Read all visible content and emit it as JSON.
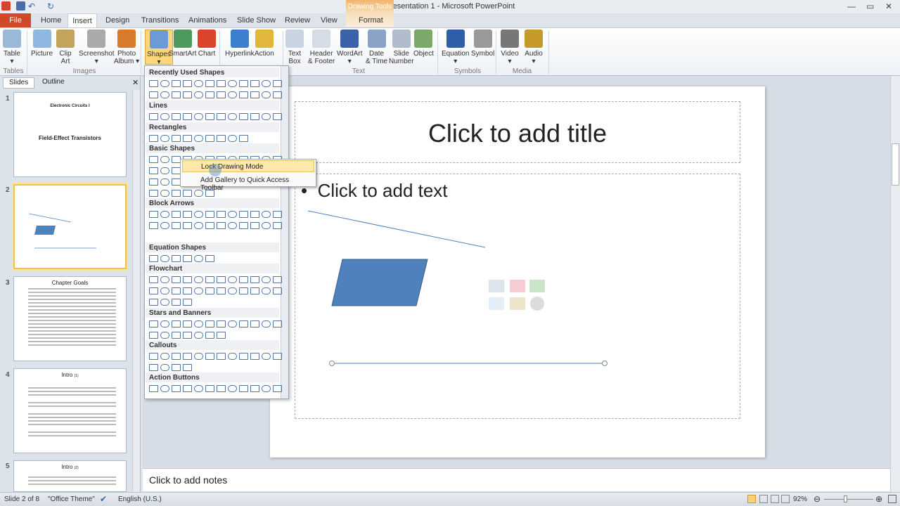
{
  "window": {
    "title": "Presentation 1  -  Microsoft PowerPoint",
    "context_tab": "Drawing Tools"
  },
  "tabs": [
    "File",
    "Home",
    "Insert",
    "Design",
    "Transitions",
    "Animations",
    "Slide Show",
    "Review",
    "View",
    "Format"
  ],
  "ribbon": {
    "buttons": [
      {
        "label": "Table",
        "sub": "▾",
        "icon": "table-icon"
      },
      {
        "label": "Picture",
        "sub": "",
        "icon": "picture-icon"
      },
      {
        "label": "Clip",
        "sub": "Art",
        "icon": "clip-art-icon"
      },
      {
        "label": "Screenshot",
        "sub": "▾",
        "icon": "screenshot-icon"
      },
      {
        "label": "Photo",
        "sub": "Album ▾",
        "icon": "photo-album-icon"
      },
      {
        "label": "Shapes",
        "sub": "▾",
        "icon": "shapes-icon"
      },
      {
        "label": "SmartArt",
        "sub": "",
        "icon": "smartart-icon"
      },
      {
        "label": "Chart",
        "sub": "",
        "icon": "chart-icon"
      },
      {
        "label": "Hyperlink",
        "sub": "",
        "icon": "hyperlink-icon"
      },
      {
        "label": "Action",
        "sub": "",
        "icon": "action-icon"
      },
      {
        "label": "Text",
        "sub": "Box",
        "icon": "text-box-icon"
      },
      {
        "label": "Header",
        "sub": "& Footer",
        "icon": "header-footer-icon"
      },
      {
        "label": "WordArt",
        "sub": "▾",
        "icon": "wordart-icon"
      },
      {
        "label": "Date",
        "sub": "& Time",
        "icon": "date-time-icon"
      },
      {
        "label": "Slide",
        "sub": "Number",
        "icon": "slide-number-icon"
      },
      {
        "label": "Object",
        "sub": "",
        "icon": "object-icon"
      },
      {
        "label": "Equation",
        "sub": "▾",
        "icon": "equation-icon"
      },
      {
        "label": "Symbol",
        "sub": "",
        "icon": "symbol-icon"
      },
      {
        "label": "Video",
        "sub": "▾",
        "icon": "video-icon"
      },
      {
        "label": "Audio",
        "sub": "▾",
        "icon": "audio-icon"
      }
    ],
    "groups": [
      "Tables",
      "Images",
      "Text",
      "Symbols",
      "Media"
    ]
  },
  "pane": {
    "tabs": [
      "Slides",
      "Outline"
    ],
    "thumbs": [
      {
        "num": "1",
        "title": "Electronic Circuits I",
        "subtitle": "Field-Effect Transistors"
      },
      {
        "num": "2",
        "title": "",
        "subtitle": ""
      },
      {
        "num": "3",
        "title": "Chapter Goals",
        "subtitle": ""
      },
      {
        "num": "4",
        "title": "Intro",
        "subtitle": "(1)"
      },
      {
        "num": "5",
        "title": "Intro",
        "subtitle": "(2)"
      }
    ]
  },
  "gallery": {
    "sections": [
      "Recently Used Shapes",
      "Lines",
      "Rectangles",
      "Basic Shapes",
      "Block Arrows",
      "Equation Shapes",
      "Flowchart",
      "Stars and Banners",
      "Callouts",
      "Action Buttons"
    ]
  },
  "context_menu": {
    "items": [
      "Lock Drawing Mode",
      "Add Gallery to Quick Access Toolbar"
    ]
  },
  "slide": {
    "title_placeholder": "Click to add title",
    "body_placeholder": "Click to add text",
    "bullet": "•"
  },
  "notes": {
    "placeholder": "Click to add notes"
  },
  "status": {
    "slide": "Slide 2 of 8",
    "theme": "\"Office Theme\"",
    "language": "English (U.S.)",
    "zoom": "92%",
    "zoom_percent": 92
  },
  "colors": {
    "file_tab": "#d24726",
    "shape_fill": "#4f81bd",
    "accent": "#f0c14b"
  }
}
